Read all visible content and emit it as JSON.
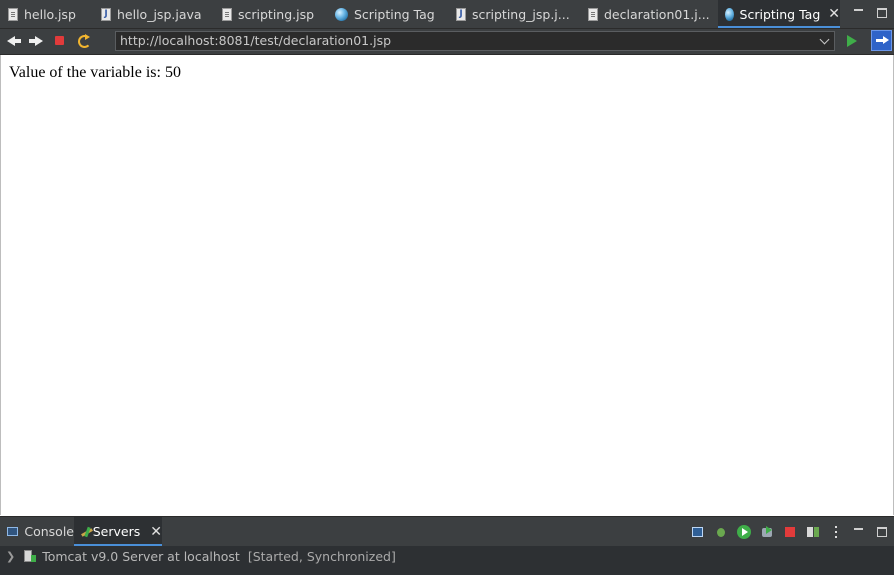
{
  "editor_tabs": [
    {
      "label": "hello.jsp",
      "icon": "jsp-file-icon",
      "active": false
    },
    {
      "label": "hello_jsp.java",
      "icon": "java-file-icon",
      "active": false
    },
    {
      "label": "scripting.jsp",
      "icon": "jsp-file-icon",
      "active": false
    },
    {
      "label": "Scripting Tag",
      "icon": "browser-globe-icon",
      "active": false
    },
    {
      "label": "scripting_jsp.j...",
      "icon": "java-file-icon",
      "active": false
    },
    {
      "label": "declaration01.j...",
      "icon": "jsp-file-icon",
      "active": false
    },
    {
      "label": "Scripting Tag",
      "icon": "browser-globe-icon",
      "active": true
    }
  ],
  "toolbar": {
    "url": "http://localhost:8081/test/declaration01.jsp"
  },
  "page": {
    "text": "Value of the variable is: 50"
  },
  "bottom_panel": {
    "tabs": [
      {
        "label": "Console",
        "active": false
      },
      {
        "label": "Servers",
        "active": true
      }
    ],
    "server": {
      "name": "Tomcat v9.0 Server at localhost",
      "status": "[Started, Synchronized]"
    }
  },
  "colors": {
    "chrome_bg": "#3c3f41",
    "active_tab_bg": "#2d3033",
    "accent": "#4a8fd8",
    "page_bg": "#ffffff"
  }
}
